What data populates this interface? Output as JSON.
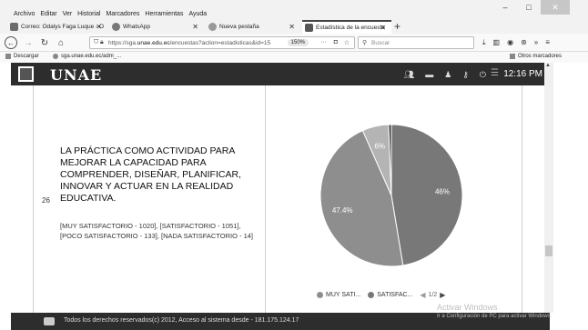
{
  "menu": [
    "Archivo",
    "Editar",
    "Ver",
    "Historial",
    "Marcadores",
    "Herramientas",
    "Ayuda"
  ],
  "window_controls": {
    "minimize": "–",
    "maximize": "□",
    "close": "✕"
  },
  "tabs": [
    {
      "label": "Correo: Odalys Faga Luque - O",
      "active": false
    },
    {
      "label": "WhatsApp",
      "active": false
    },
    {
      "label": "Nueva pestaña",
      "active": false
    },
    {
      "label": "Estadística de la encuesta",
      "active": true
    }
  ],
  "new_tab_label": "+",
  "url": {
    "prefix": "https://sga.",
    "domain": "unae.edu.ec",
    "path": "/encuestas?action=estadisticas&id=15"
  },
  "zoom": "150%",
  "search_placeholder": "Buscar",
  "bookmarks": {
    "left1": "Descargar",
    "left2": "sga.unae.edu.ec/adm_...",
    "right": "Otros marcadores"
  },
  "app": {
    "logo": "UNAE",
    "time": "12:16 PM"
  },
  "question": {
    "number": "26",
    "text": "LA PRÁCTICA COMO ACTIVIDAD PARA MEJORAR LA CAPACIDAD PARA COMPRENDER, DISEÑAR, PLANIFICAR, INNOVAR Y ACTUAR EN LA REALIDAD EDUCATIVA.",
    "answers": "[MUY SATISFACTORIO - 1020], [SATISFACTORIO - 1051], [POCO SATISFACTORIO - 133], [NADA SATISFACTORIO - 14]"
  },
  "chart_data": {
    "type": "pie",
    "slices": [
      {
        "label": "SATISFACTORIO",
        "value": 1051,
        "display": "46%",
        "color": "#787878"
      },
      {
        "label": "MUY SATISFACTORIO",
        "value": 1020,
        "display": "47.4%",
        "color": "#8e8e8e"
      },
      {
        "label": "POCO SATISFACTORIO",
        "value": 133,
        "display": "6%",
        "color": "#b4b4b4"
      },
      {
        "label": "NADA SATISFACTORIO",
        "value": 14,
        "display": "",
        "color": "#3a3a3a"
      }
    ],
    "legend": [
      {
        "label": "MUY SATI...",
        "color": "#8e8e8e"
      },
      {
        "label": "SATISFAC...",
        "color": "#787878"
      }
    ],
    "legend_placement": "bottom",
    "page": "1/2"
  },
  "footer": "Todos los derechos reservados(c) 2012, Acceso al sistema desde - 181.175.124.17",
  "watermark": {
    "line1": "Activar Windows",
    "line2": "Ir a Configuración de PC para activar Windows."
  }
}
